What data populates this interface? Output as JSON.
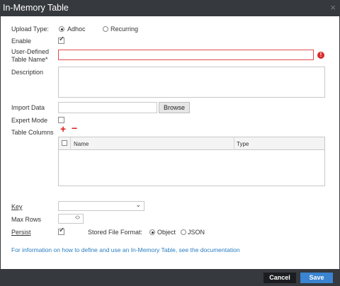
{
  "dialog": {
    "title": "In-Memory Table",
    "close_icon": "×"
  },
  "form": {
    "upload_type": {
      "label": "Upload Type:",
      "options": [
        "Adhoc",
        "Recurring"
      ],
      "selected": "Adhoc"
    },
    "enable": {
      "label": "Enable",
      "checked": true
    },
    "table_name": {
      "label_line1": "User-Defined",
      "label_line2": "Table Name*",
      "value": "",
      "error_icon": "!"
    },
    "description": {
      "label": "Description",
      "value": ""
    },
    "import_data": {
      "label": "Import Data",
      "value": "",
      "browse_label": "Browse"
    },
    "expert_mode": {
      "label": "Expert Mode",
      "checked": false
    },
    "table_columns": {
      "label": "Table Columns",
      "add_icon": "+",
      "remove_icon": "−",
      "headers": [
        "Name",
        "Type"
      ],
      "rows": []
    },
    "key": {
      "label": "Key",
      "value": ""
    },
    "max_rows": {
      "label": "Max Rows",
      "value": ""
    },
    "persist": {
      "label": "Persist",
      "checked": true,
      "format_label": "Stored File Format:",
      "format_options": [
        "Object",
        "JSON"
      ],
      "selected_format": "Object"
    },
    "info_link": "For information on how to define and use an In-Memory Table, see the documentation"
  },
  "footer": {
    "cancel_label": "Cancel",
    "save_label": "Save"
  },
  "colors": {
    "title_bar": "#36393d",
    "accent": "#3a84d1",
    "error": "#e34b4b",
    "link": "#2a7ec2",
    "add_remove": "#e01b1b"
  }
}
